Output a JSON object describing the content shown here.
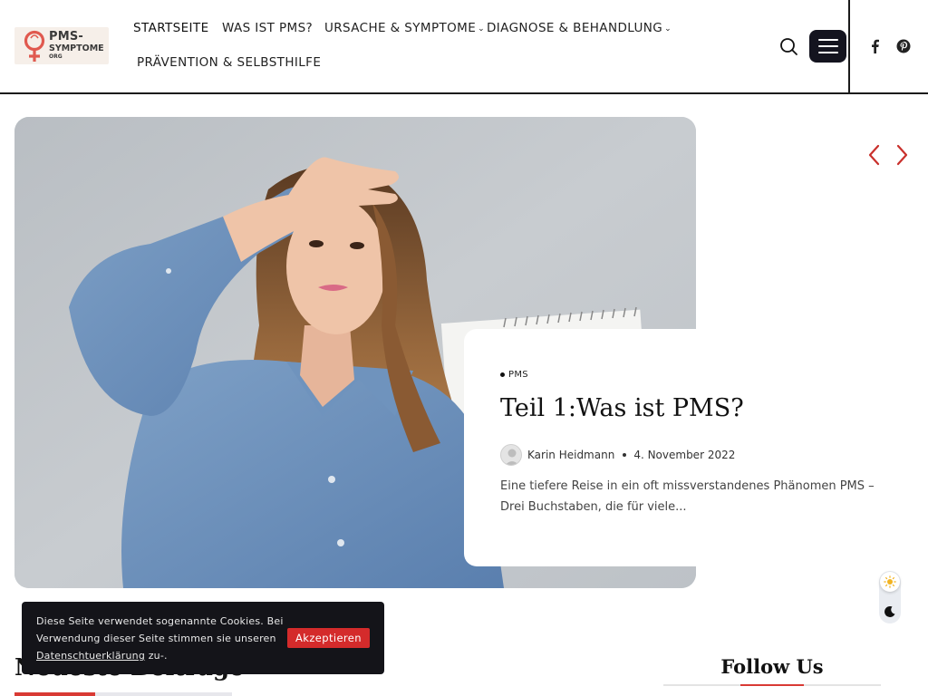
{
  "brand": {
    "logo_line1": "PMS-",
    "logo_line2": "SYMPTOME",
    "logo_line3": "ORG",
    "accent_color": "#d93a34"
  },
  "nav": {
    "items": [
      {
        "label": "STARTSEITE",
        "has_dropdown": false
      },
      {
        "label": "WAS IST PMS?",
        "has_dropdown": false
      },
      {
        "label": "URSACHE & SYMPTOME",
        "has_dropdown": true
      },
      {
        "label": "DIAGNOSE & BEHANDLUNG",
        "has_dropdown": true
      },
      {
        "label": "PRÄVENTION & SELBSTHILFE",
        "has_dropdown": false
      }
    ],
    "dropdown_icon": "chevron-down-icon"
  },
  "header_actions": {
    "search_icon": "search-icon",
    "menu_icon": "hamburger-icon",
    "social": [
      "facebook-icon",
      "pinterest-icon"
    ]
  },
  "slider": {
    "prev_icon": "chevron-left-icon",
    "next_icon": "chevron-right-icon"
  },
  "featured_post": {
    "category": "PMS",
    "title": "Teil 1:Was ist PMS?",
    "author": "Karin Heidmann",
    "date": "4. November 2022",
    "excerpt": "Eine tiefere Reise in ein oft missverstandenes Phänomen PMS – Drei Buchstaben, die für viele..."
  },
  "theme_toggle": {
    "light_icon": "sun-icon",
    "dark_icon": "moon-icon"
  },
  "sections": {
    "latest_title": "Neueste Beiträge",
    "follow_title": "Follow Us"
  },
  "cookie": {
    "text_before_link": "Diese Seite verwendet sogenannte Cookies. Bei Verwendung dieser Seite stimmen sie unseren ",
    "link_label": "Datenschtuerklärung",
    "text_after_link": " zu-.",
    "accept_label": "Akzeptieren"
  }
}
